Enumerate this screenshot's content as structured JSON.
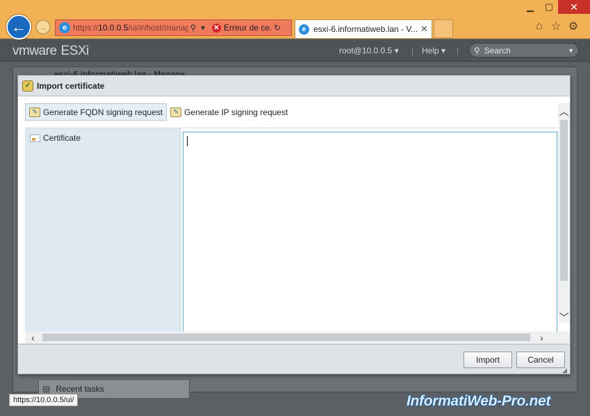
{
  "browser": {
    "url_prefix": "https://",
    "url_host": "10.0.0.5",
    "url_path": "/ui/#/host/manage",
    "cert_error": "Erreur de ce...",
    "tab_title": "esxi-6.informatiweb.lan - V...",
    "status_url": "https://10.0.0.5/ui/"
  },
  "esxi": {
    "brand_vm": "vmware",
    "brand_product": "ESXi",
    "user": "root@10.0.0.5",
    "help": "Help",
    "search_placeholder": "Search",
    "background_title": "esxi-6.informatiweb.lan - Manage",
    "recent_tasks": "Recent tasks"
  },
  "dialog": {
    "title": "Import certificate",
    "toolbar": [
      {
        "label": "Generate FQDN signing request"
      },
      {
        "label": "Generate IP signing request"
      }
    ],
    "field_label": "Certificate",
    "certificate_value": "",
    "buttons": {
      "import": "Import",
      "cancel": "Cancel"
    }
  },
  "watermark": "InformatiWeb-Pro.net",
  "colors": {
    "ie_chrome": "#f3b155",
    "address_error": "#f17a5c",
    "esxi_header": "#4e5358",
    "label_column": "#dfe9f1",
    "textarea_border": "#5ea3c8"
  }
}
